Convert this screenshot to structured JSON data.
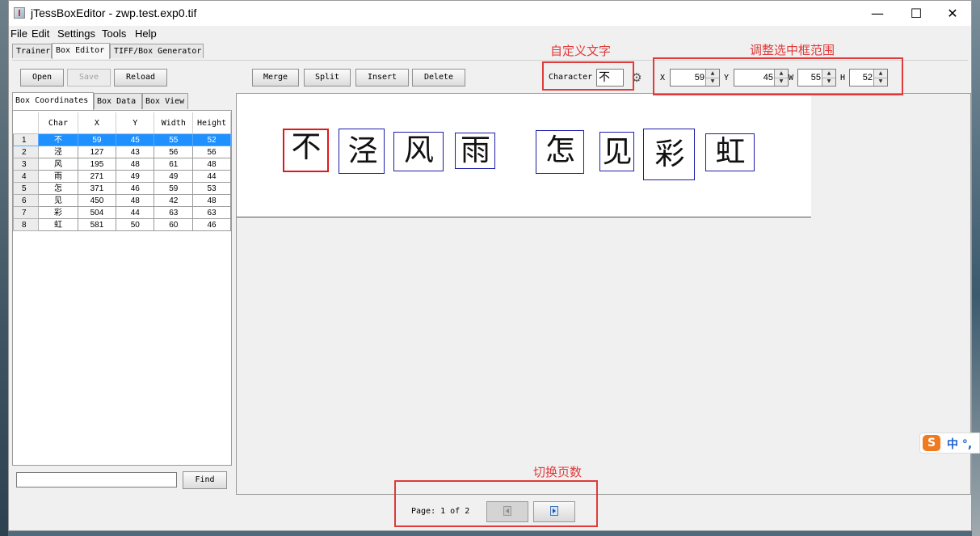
{
  "window": {
    "title": "jTessBoxEditor - zwp.test.exp0.tif"
  },
  "menu": [
    "File",
    "Edit",
    "Settings",
    "Tools",
    "Help"
  ],
  "tabs": [
    "Trainer",
    "Box Editor",
    "TIFF/Box Generator"
  ],
  "toolbar": {
    "open": "Open",
    "save": "Save",
    "reload": "Reload",
    "merge": "Merge",
    "split": "Split",
    "insert": "Insert",
    "delete": "Delete",
    "character_label": "Character",
    "character_value": "不",
    "x_label": "X",
    "x_value": "59",
    "y_label": "Y",
    "y_value": "45",
    "w_label": "W",
    "w_value": "55",
    "h_label": "H",
    "h_value": "52"
  },
  "left_panel": {
    "tabs": [
      "Box Coordinates",
      "Box Data",
      "Box View"
    ],
    "columns": [
      "Char",
      "X",
      "Y",
      "Width",
      "Height"
    ],
    "rows": [
      {
        "n": "1",
        "char": "不",
        "x": "59",
        "y": "45",
        "w": "55",
        "h": "52"
      },
      {
        "n": "2",
        "char": "泾",
        "x": "127",
        "y": "43",
        "w": "56",
        "h": "56"
      },
      {
        "n": "3",
        "char": "风",
        "x": "195",
        "y": "48",
        "w": "61",
        "h": "48"
      },
      {
        "n": "4",
        "char": "雨",
        "x": "271",
        "y": "49",
        "w": "49",
        "h": "44"
      },
      {
        "n": "5",
        "char": "怎",
        "x": "371",
        "y": "46",
        "w": "59",
        "h": "53"
      },
      {
        "n": "6",
        "char": "见",
        "x": "450",
        "y": "48",
        "w": "42",
        "h": "48"
      },
      {
        "n": "7",
        "char": "彩",
        "x": "504",
        "y": "44",
        "w": "63",
        "h": "63"
      },
      {
        "n": "8",
        "char": "虹",
        "x": "581",
        "y": "50",
        "w": "60",
        "h": "46"
      }
    ],
    "find_button": "Find"
  },
  "canvas": {
    "glyphs": [
      "不",
      "泾",
      "风",
      "雨",
      "怎",
      "见",
      "彩",
      "虹"
    ]
  },
  "pager": {
    "label": "Page: 1 of 2"
  },
  "annotations": {
    "custom_text": "自定义文字",
    "adjust_box": "调整选中框范围",
    "switch_page": "切换页数"
  },
  "ime": {
    "logo": "S",
    "text": "中 °,"
  },
  "colors": {
    "selection": "#1e90ff",
    "annotation": "#e03a3a",
    "box": "#1c1ca8",
    "selected_box": "#e01818"
  }
}
